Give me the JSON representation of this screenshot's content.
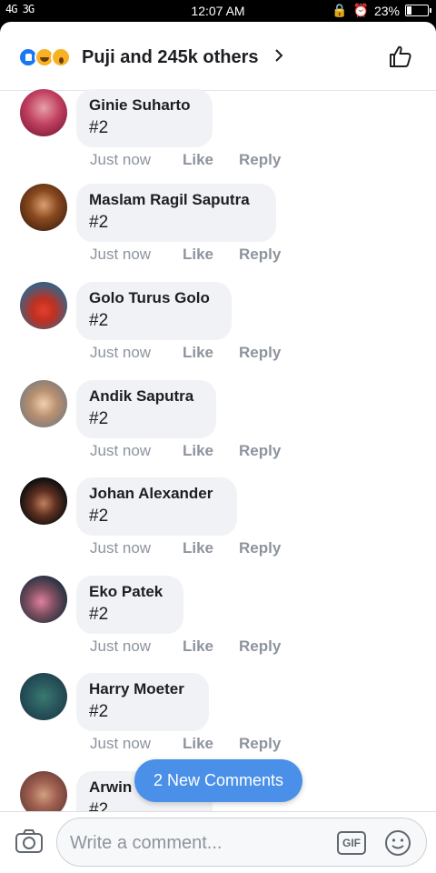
{
  "status_bar": {
    "signal": "4G 3G",
    "time": "12:07 AM",
    "battery": "23%",
    "battery_level": 0.23
  },
  "reactions": {
    "summary": "Puji and 245k others",
    "icons": [
      "like-icon",
      "haha-icon",
      "wow-icon"
    ]
  },
  "comments": [
    {
      "name": "Ginie Suharto",
      "text": "#2",
      "time": "Just now",
      "like": "Like",
      "reply": "Reply"
    },
    {
      "name": "Maslam Ragil Saputra",
      "text": "#2",
      "time": "Just now",
      "like": "Like",
      "reply": "Reply"
    },
    {
      "name": "Golo Turus Golo",
      "text": "#2",
      "time": "Just now",
      "like": "Like",
      "reply": "Reply"
    },
    {
      "name": "Andik Saputra",
      "text": "#2",
      "time": "Just now",
      "like": "Like",
      "reply": "Reply"
    },
    {
      "name": "Johan Alexander",
      "text": "#2",
      "time": "Just now",
      "like": "Like",
      "reply": "Reply"
    },
    {
      "name": "Eko Patek",
      "text": "#2",
      "time": "Just now",
      "like": "Like",
      "reply": "Reply"
    },
    {
      "name": "Harry Moeter",
      "text": "#2",
      "time": "Just now",
      "like": "Like",
      "reply": "Reply"
    },
    {
      "name": "Arwin",
      "text": "#2"
    }
  ],
  "new_comments_label": "2 New Comments",
  "composer": {
    "placeholder": "Write a comment...",
    "gif_label": "GIF"
  },
  "colors": {
    "accent": "#1877f2",
    "pill": "#4a90e8",
    "bubble": "#f0f2f5",
    "muted": "#8d949e"
  }
}
